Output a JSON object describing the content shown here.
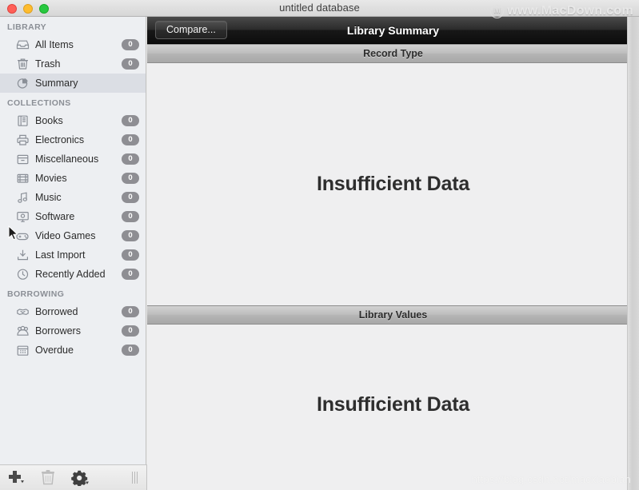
{
  "window": {
    "title": "untitled database",
    "traffic_lights": [
      "close",
      "minimize",
      "maximize"
    ]
  },
  "toolbar": {
    "compare_label": "Compare...",
    "title": "Library Summary"
  },
  "sidebar": {
    "sections": [
      {
        "header": "LIBRARY",
        "items": [
          {
            "label": "All Items",
            "badge": "0",
            "icon": "inbox-icon",
            "selected": false
          },
          {
            "label": "Trash",
            "badge": "0",
            "icon": "trash-icon",
            "selected": false
          },
          {
            "label": "Summary",
            "badge": "",
            "icon": "pie-chart-icon",
            "selected": true
          }
        ]
      },
      {
        "header": "COLLECTIONS",
        "items": [
          {
            "label": "Books",
            "badge": "0",
            "icon": "book-icon",
            "selected": false
          },
          {
            "label": "Electronics",
            "badge": "0",
            "icon": "printer-icon",
            "selected": false
          },
          {
            "label": "Miscellaneous",
            "badge": "0",
            "icon": "box-icon",
            "selected": false
          },
          {
            "label": "Movies",
            "badge": "0",
            "icon": "film-icon",
            "selected": false
          },
          {
            "label": "Music",
            "badge": "0",
            "icon": "music-note-icon",
            "selected": false
          },
          {
            "label": "Software",
            "badge": "0",
            "icon": "monitor-icon",
            "selected": false
          },
          {
            "label": "Video Games",
            "badge": "0",
            "icon": "gamepad-icon",
            "selected": false
          },
          {
            "label": "Last Import",
            "badge": "0",
            "icon": "download-icon",
            "selected": false
          },
          {
            "label": "Recently Added",
            "badge": "0",
            "icon": "clock-icon",
            "selected": false
          }
        ]
      },
      {
        "header": "BORROWING",
        "items": [
          {
            "label": "Borrowed",
            "badge": "0",
            "icon": "handshake-icon",
            "selected": false
          },
          {
            "label": "Borrowers",
            "badge": "0",
            "icon": "people-icon",
            "selected": false
          },
          {
            "label": "Overdue",
            "badge": "0",
            "icon": "calendar-icon",
            "selected": false
          }
        ]
      }
    ],
    "bottom_bar": [
      {
        "name": "add-button",
        "icon": "plus-icon",
        "enabled": true
      },
      {
        "name": "delete-button",
        "icon": "trash-icon",
        "enabled": false
      },
      {
        "name": "action-button",
        "icon": "gear-icon",
        "enabled": true
      }
    ]
  },
  "main": {
    "sections": [
      {
        "header": "Record Type",
        "body": "Insufficient Data"
      },
      {
        "header": "Library Values",
        "body": "Insufficient Data"
      }
    ]
  },
  "watermarks": {
    "top": "www.MacDown.com",
    "top_logo": "M",
    "bottom": "https://blog.csdn.net/macxiaobian"
  },
  "colors": {
    "sidebar_bg": "#edeff2",
    "selected_row": "#dbdee4",
    "badge_bg": "#8e8e93",
    "toolbar_bg": "#1b1b1b",
    "content_bg": "#efeff0"
  }
}
